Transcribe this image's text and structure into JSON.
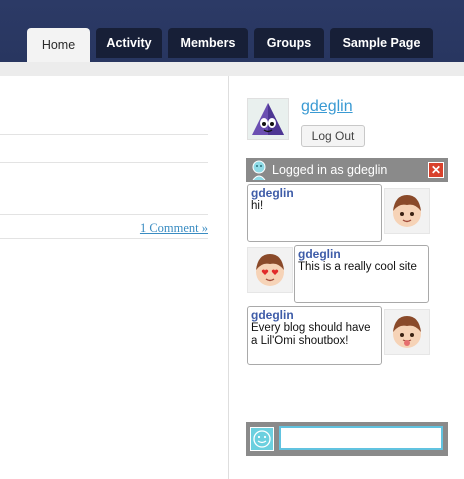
{
  "nav": {
    "tabs": [
      {
        "label": "Home",
        "active": true
      },
      {
        "label": "Activity",
        "active": false
      },
      {
        "label": "Members",
        "active": false
      },
      {
        "label": "Groups",
        "active": false
      },
      {
        "label": "Sample Page",
        "active": false
      }
    ]
  },
  "main": {
    "comment_link": "1 Comment »"
  },
  "sidebar": {
    "username": "gdeglin",
    "logout_label": "Log Out",
    "shoutbox": {
      "status": "Logged in as gdeglin",
      "close_symbol": "✕",
      "messages": [
        {
          "user": "gdeglin",
          "text": "hi!",
          "avatar": "boy-smiling-icon"
        },
        {
          "user": "gdeglin",
          "text": "This is a really cool site",
          "avatar": "heart-eyes-face-icon"
        },
        {
          "user": "gdeglin",
          "text": "Every blog should have a Lil'Omi shoutbox!",
          "avatar": "tongue-out-face-icon"
        }
      ],
      "input_value": ""
    }
  },
  "colors": {
    "header": "#283660",
    "tab_dark": "#171f37",
    "link": "#3a9ad3",
    "shout_user": "#3e5ca8",
    "close": "#d9412c",
    "input_border": "#61c3e0"
  }
}
